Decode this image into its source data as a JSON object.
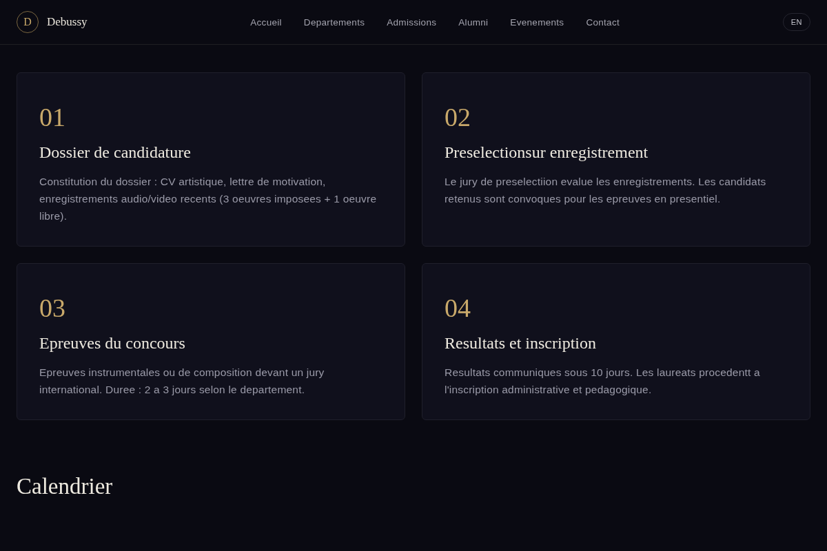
{
  "header": {
    "logo_letter": "D",
    "brand": "Debussy",
    "nav": [
      {
        "label": "Accueil"
      },
      {
        "label": "Departements"
      },
      {
        "label": "Admissions"
      },
      {
        "label": "Alumni"
      },
      {
        "label": "Evenements"
      },
      {
        "label": "Contact"
      }
    ],
    "language": "EN"
  },
  "steps": [
    {
      "number": "01",
      "title": "Dossier de candidature",
      "text": "Constitution du dossier : CV artistique, lettre de motivation, enregistrements audio/video recents (3 oeuvres imposees + 1 oeuvre libre)."
    },
    {
      "number": "02",
      "title": "Preselectionsur enregistrement",
      "text": "Le jury de preselectiion evalue les enregistrements. Les candidats retenus sont convoques pour les epreuves en presentiel."
    },
    {
      "number": "03",
      "title": "Epreuves du concours",
      "text": "Epreuves instrumentales ou de composition devant un jury international. Duree : 2 a 3 jours selon le departement."
    },
    {
      "number": "04",
      "title": "Resultats et inscription",
      "text": "Resultats communiques sous 10 jours. Les laureats procedentt a l'inscription administrative et pedagogique."
    }
  ],
  "section_title": "Calendrier"
}
